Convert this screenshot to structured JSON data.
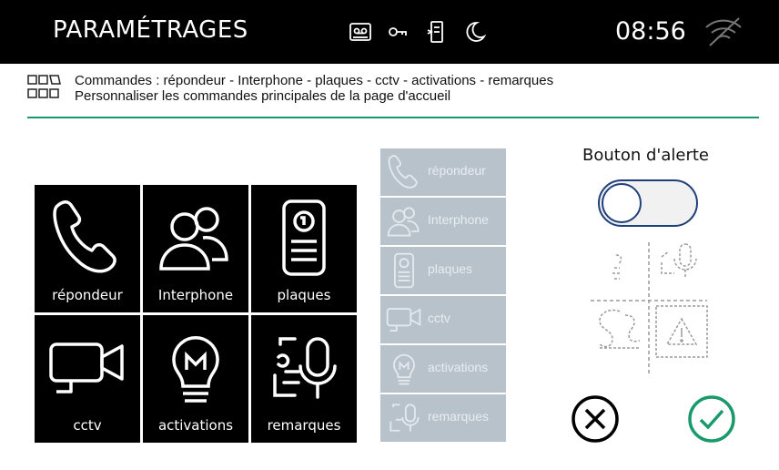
{
  "header": {
    "title": "PARAMÉTRAGES",
    "time": "08:56",
    "status_icons": [
      "voicemail-icon",
      "key-icon",
      "door-phone-icon",
      "moon-icon"
    ],
    "wifi_icon": "wifi-off-icon"
  },
  "subheader": {
    "line1": "Commandes : répondeur - Interphone - plaques - cctv - activations - remarques",
    "line2": "Personnaliser les commandes principales de la page d'accueil"
  },
  "main_tiles": [
    {
      "label": "répondeur",
      "icon": "phone-icon"
    },
    {
      "label": "Interphone",
      "icon": "people-icon"
    },
    {
      "label": "plaques",
      "icon": "door-panel-icon"
    },
    {
      "label": "cctv",
      "icon": "camera-icon"
    },
    {
      "label": "activations",
      "icon": "bulb-icon"
    },
    {
      "label": "remarques",
      "icon": "note-mic-icon"
    }
  ],
  "available_commands": [
    {
      "label": "répondeur",
      "icon": "phone-icon"
    },
    {
      "label": "Interphone",
      "icon": "people-icon"
    },
    {
      "label": "plaques",
      "icon": "door-panel-icon"
    },
    {
      "label": "cctv",
      "icon": "camera-icon"
    },
    {
      "label": "activations",
      "icon": "bulb-icon"
    },
    {
      "label": "remarques",
      "icon": "note-mic-icon"
    }
  ],
  "alert": {
    "title": "Bouton d'alerte",
    "toggle_on": false
  },
  "colors": {
    "accent_green": "#1a9a6c",
    "toggle_border": "#1f3f7a",
    "disabled_tile": "#b8c2cb"
  }
}
